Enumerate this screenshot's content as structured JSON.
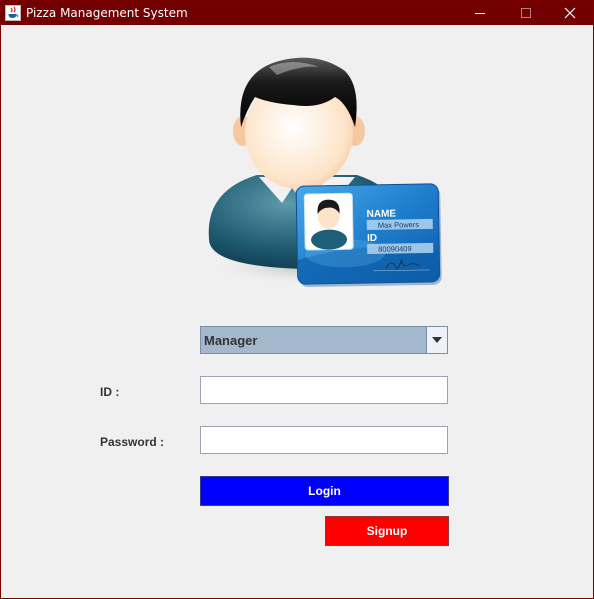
{
  "window": {
    "title": "Pizza Management System"
  },
  "hero": {
    "card_name_label": "NAME",
    "card_name_value": "Max Powers",
    "card_id_label": "ID",
    "card_id_value": "80090409"
  },
  "form": {
    "role_selected": "Manager",
    "id_label": "ID :",
    "id_value": "",
    "password_label": "Password :",
    "password_value": ""
  },
  "buttons": {
    "login": "Login",
    "signup": "Signup"
  },
  "colors": {
    "titlebar": "#720000",
    "login": "#0000ff",
    "signup": "#ff0000",
    "select": "#a3b8cc"
  }
}
